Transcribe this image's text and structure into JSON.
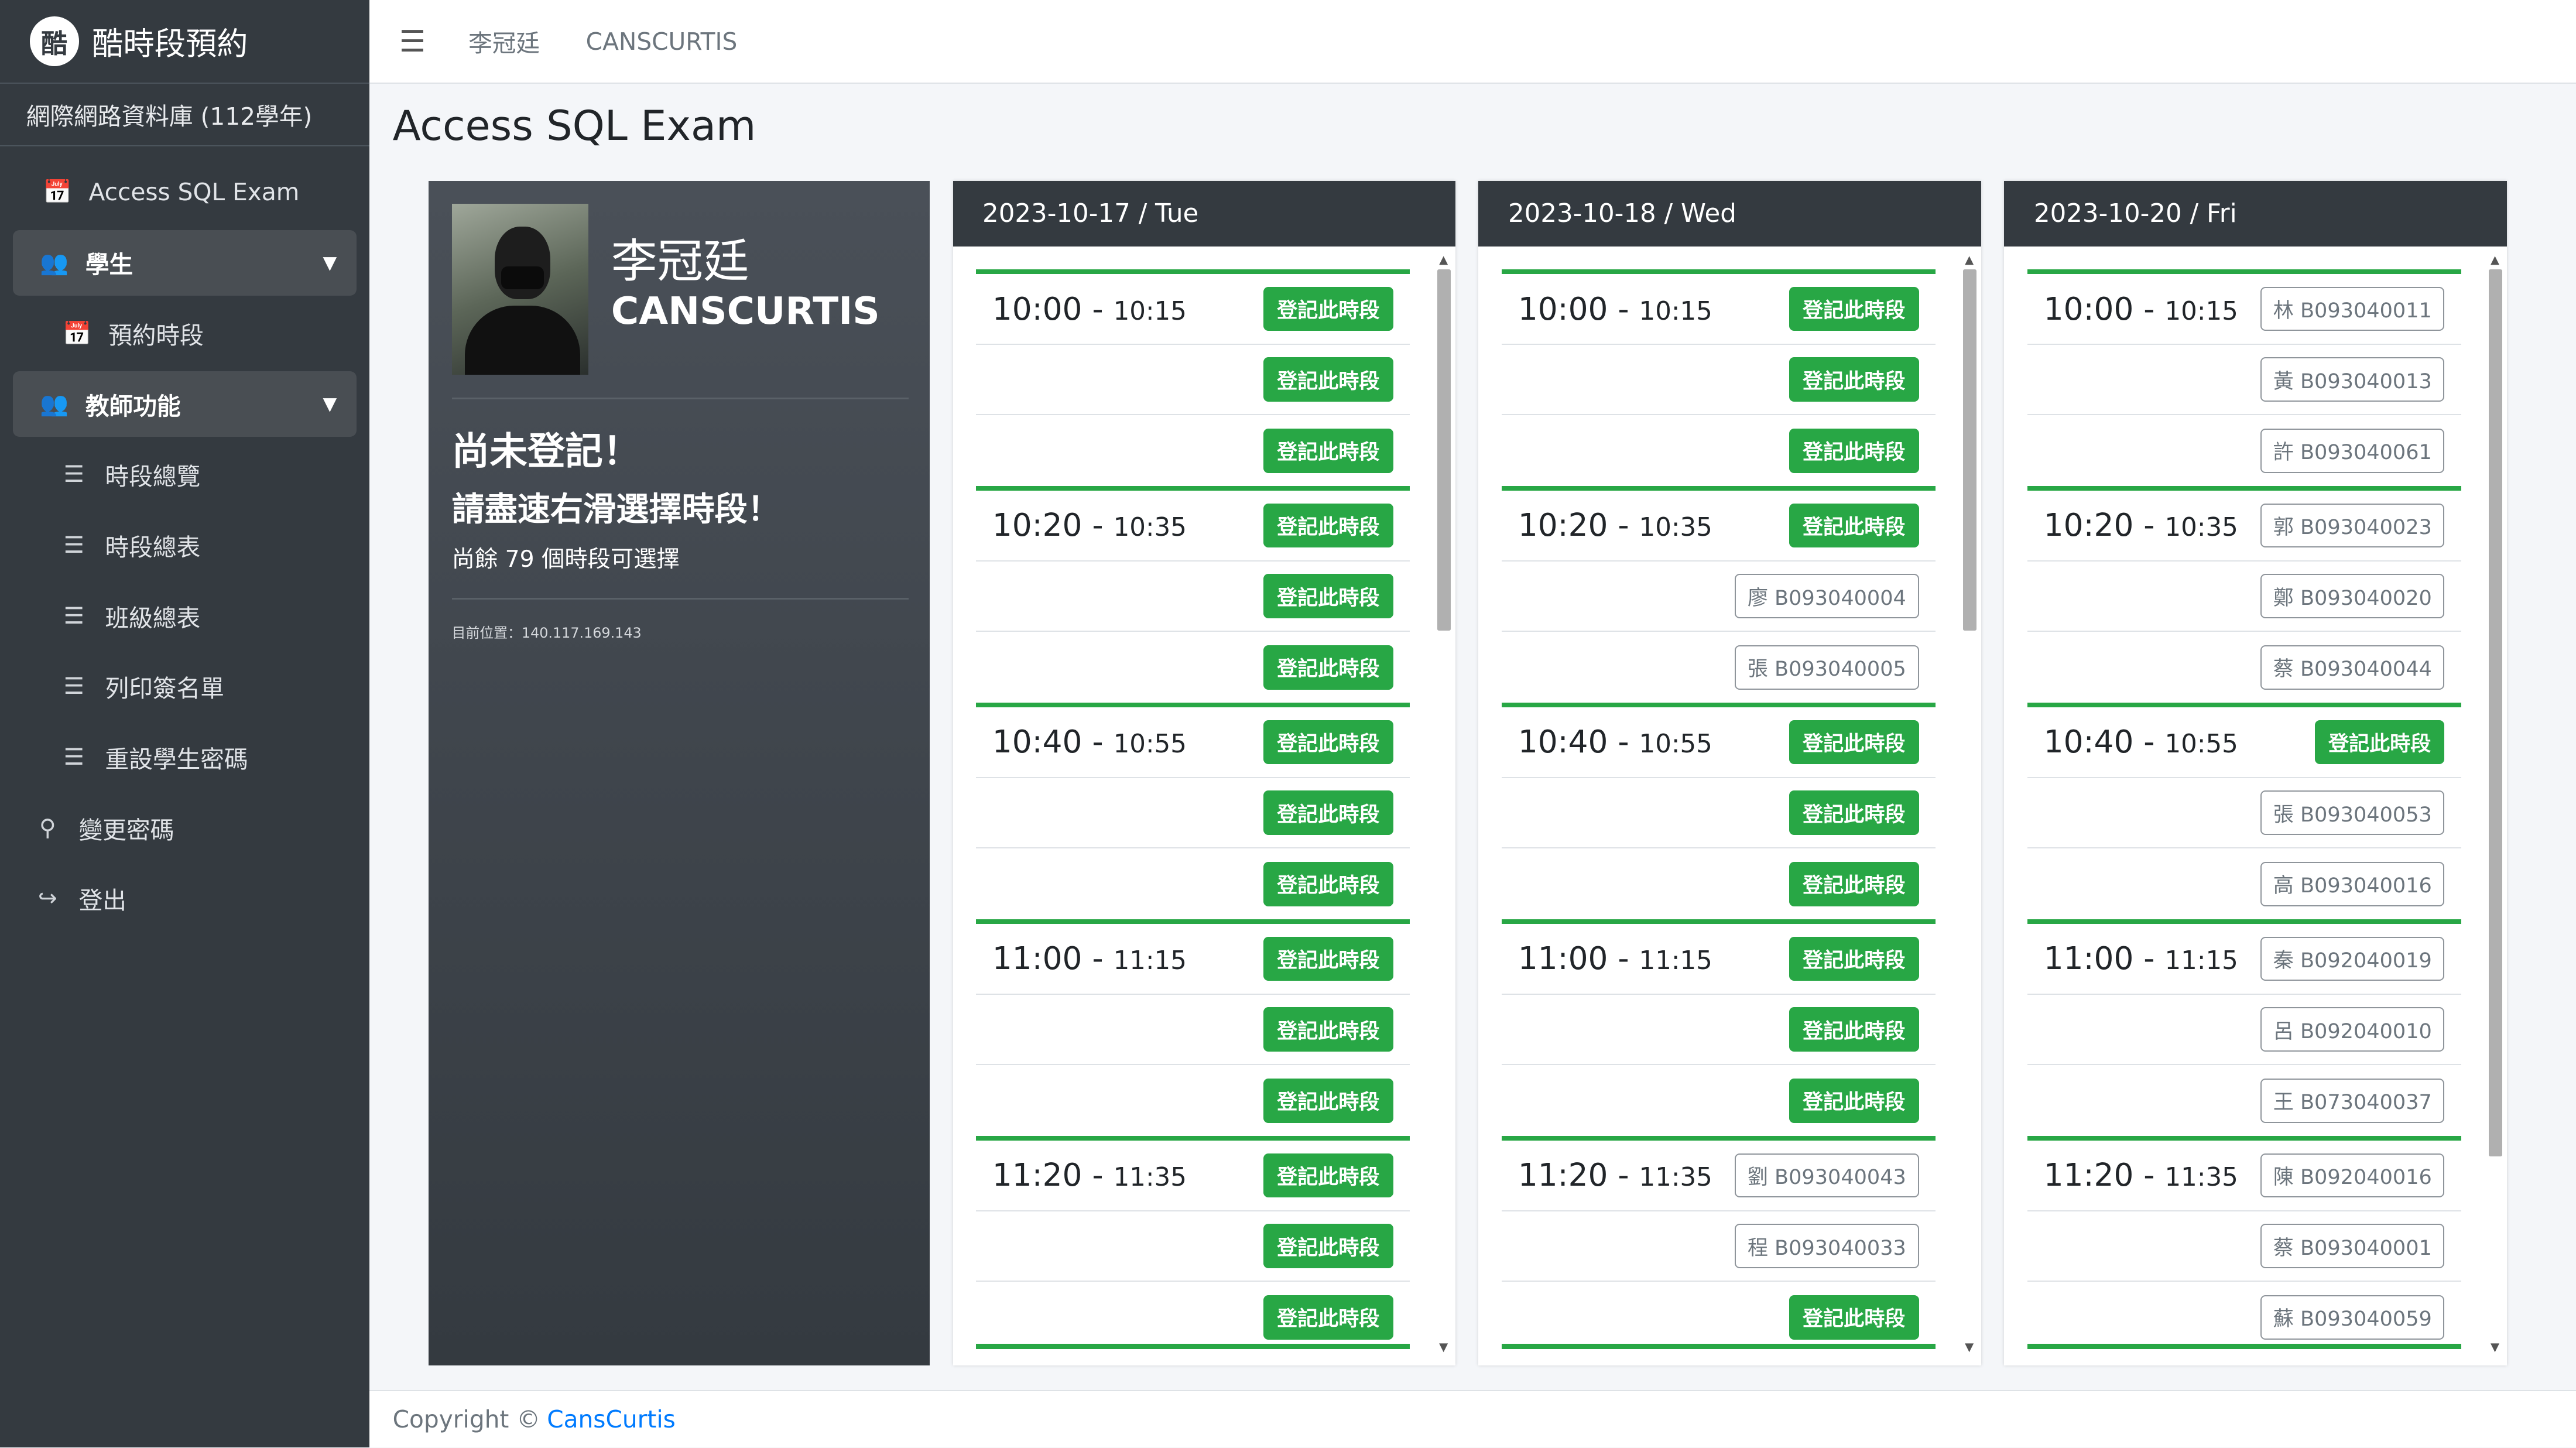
{
  "brand": {
    "logo_char": "酷",
    "title": "酷時段預約"
  },
  "course": "網際網路資料庫 (112學年)",
  "sidebar": {
    "items": [
      {
        "label": "Access SQL Exam",
        "icon": "calendar-icon"
      },
      {
        "label": "學生",
        "icon": "users-icon"
      },
      {
        "label": "預約時段",
        "icon": "calendar-icon"
      },
      {
        "label": "教師功能",
        "icon": "users-icon"
      },
      {
        "label": "時段總覽",
        "icon": "list-icon"
      },
      {
        "label": "時段總表",
        "icon": "list-icon"
      },
      {
        "label": "班級總表",
        "icon": "list-icon"
      },
      {
        "label": "列印簽名單",
        "icon": "list-icon"
      },
      {
        "label": "重設學生密碼",
        "icon": "list-icon"
      },
      {
        "label": "變更密碼",
        "icon": "key-icon"
      },
      {
        "label": "登出",
        "icon": "logout-icon"
      }
    ]
  },
  "topbar": {
    "menu_icon": "menu-icon",
    "link1": "李冠廷",
    "link2": "CANSCURTIS"
  },
  "page_title": "Access SQL Exam",
  "profile": {
    "name": "李冠廷",
    "nickname": "CANSCURTIS",
    "status_title": "尚未登記！",
    "status_prompt": "請盡速右滑選擇時段！",
    "remaining": "尚餘 79 個時段可選擇",
    "location": "目前位置：140.117.169.143"
  },
  "register_label": "登記此時段",
  "days": [
    {
      "header": "2023-10-17 / Tue",
      "groups": [
        {
          "start": "10:00",
          "end": "10:15",
          "rows": [
            null,
            null,
            null
          ]
        },
        {
          "start": "10:20",
          "end": "10:35",
          "rows": [
            null,
            null,
            null
          ]
        },
        {
          "start": "10:40",
          "end": "10:55",
          "rows": [
            null,
            null,
            null
          ]
        },
        {
          "start": "11:00",
          "end": "11:15",
          "rows": [
            null,
            null,
            null
          ]
        },
        {
          "start": "11:20",
          "end": "11:35",
          "rows": [
            null,
            null,
            null
          ]
        }
      ]
    },
    {
      "header": "2023-10-18 / Wed",
      "groups": [
        {
          "start": "10:00",
          "end": "10:15",
          "rows": [
            null,
            null,
            null
          ]
        },
        {
          "start": "10:20",
          "end": "10:35",
          "rows": [
            null,
            "廖 B093040004",
            "張 B093040005"
          ]
        },
        {
          "start": "10:40",
          "end": "10:55",
          "rows": [
            null,
            null,
            null
          ]
        },
        {
          "start": "11:00",
          "end": "11:15",
          "rows": [
            null,
            null,
            null
          ]
        },
        {
          "start": "11:20",
          "end": "11:35",
          "rows": [
            "劉 B093040043",
            "程 B093040033",
            null
          ]
        }
      ]
    },
    {
      "header": "2023-10-20 / Fri",
      "groups": [
        {
          "start": "10:00",
          "end": "10:15",
          "rows": [
            "林 B093040011",
            "黃 B093040013",
            "許 B093040061"
          ]
        },
        {
          "start": "10:20",
          "end": "10:35",
          "rows": [
            "郭 B093040023",
            "鄭 B093040020",
            "蔡 B093040044"
          ]
        },
        {
          "start": "10:40",
          "end": "10:55",
          "rows": [
            null,
            "張 B093040053",
            "高 B093040016"
          ]
        },
        {
          "start": "11:00",
          "end": "11:15",
          "rows": [
            "秦 B092040019",
            "呂 B092040010",
            "王 B073040037"
          ]
        },
        {
          "start": "11:20",
          "end": "11:35",
          "rows": [
            "陳 B092040016",
            "蔡 B093040001",
            "蘇 B093040059"
          ]
        }
      ]
    }
  ],
  "footer": {
    "text": "Copyright ©",
    "link": "CansCurtis"
  }
}
